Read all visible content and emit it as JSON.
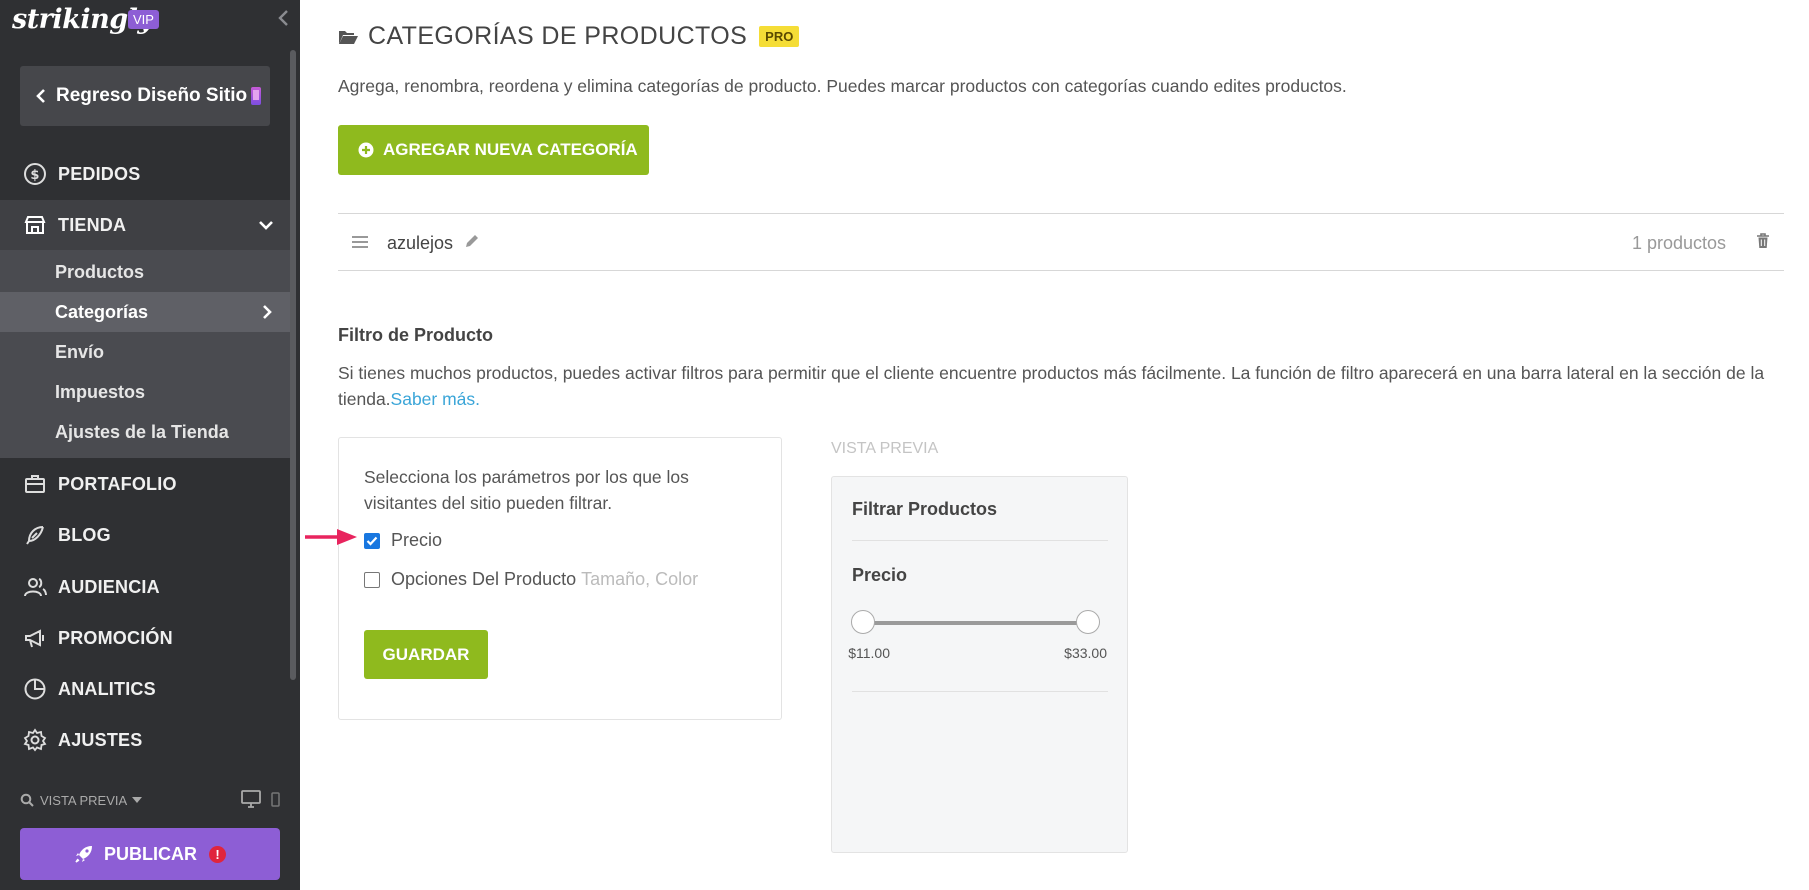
{
  "app": {
    "logo": "strikingly",
    "badge": "VIP"
  },
  "sidebar": {
    "back_button": "Regreso Diseño Sitio",
    "items": {
      "pedidos": "PEDIDOS",
      "tienda": "TIENDA",
      "portafolio": "PORTAFOLIO",
      "blog": "BLOG",
      "audiencia": "AUDIENCIA",
      "promocion": "PROMOCIÓN",
      "analitics": "ANALITICS",
      "ajustes": "AJUSTES"
    },
    "store_submenu": {
      "productos": "Productos",
      "categorias": "Categorías",
      "envio": "Envío",
      "impuestos": "Impuestos",
      "ajustes_tienda": "Ajustes de la Tienda"
    },
    "preview_label": "VISTA PREVIA",
    "publish_button": "PUBLICAR",
    "publish_alert": "!"
  },
  "main": {
    "title": "CATEGORÍAS DE PRODUCTOS",
    "pro_badge": "PRO",
    "intro": "Agrega, renombra, reordena y elimina categorías de producto. Puedes marcar productos con categorías cuando edites productos.",
    "add_button": "AGREGAR NUEVA CATEGORÍA",
    "category": {
      "name": "azulejos",
      "count": "1 productos"
    },
    "filter": {
      "title": "Filtro de Producto",
      "description": "Si tienes muchos productos, puedes activar filtros para permitir que el cliente encuentre productos más fácilmente. La función de filtro aparecerá en una barra lateral en la sección de la tienda.",
      "learn_more": "Saber más.",
      "params_text": "Selecciona los parámetros por los que los visitantes del sitio pueden filtrar.",
      "option_price": "Precio",
      "option_price_checked": true,
      "option_product": "Opciones Del Producto",
      "option_product_hint": "Tamaño, Color",
      "option_product_checked": false,
      "save_button": "GUARDAR"
    },
    "preview": {
      "label": "VISTA PREVIA",
      "title": "Filtrar Productos",
      "price_label": "Precio",
      "min_price": "$11.00",
      "max_price": "$33.00"
    }
  },
  "colors": {
    "sidebar_bg": "#2f3033",
    "accent_green": "#8fba1e",
    "accent_purple": "#8d5ed5",
    "pro_yellow": "#f5dd36",
    "link_blue": "#3aa5d8",
    "arrow_pink": "#e8245e"
  }
}
